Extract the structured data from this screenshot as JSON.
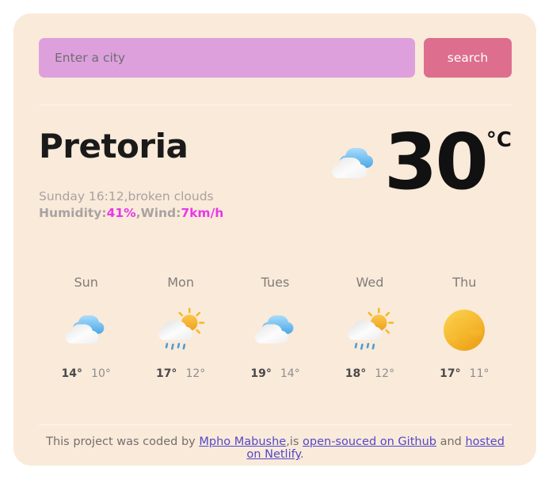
{
  "theme": {
    "page_background": "#ffffff",
    "card_background": "#faeada",
    "input_background": "#dda0dd",
    "button_background": "#dd6e8e",
    "accent_magenta": "#e838e8",
    "link_color": "#5348c8",
    "muted_text": "#a9a2a2",
    "divider_color": "#fdf6ee"
  },
  "search": {
    "placeholder": "Enter a city",
    "value": "",
    "button_label": "search"
  },
  "current": {
    "city": "Pretoria",
    "conditions_line": "Sunday 16:12,broken clouds",
    "humidity_label": "Humidity:",
    "humidity_value": "41%",
    "separator": ",",
    "wind_label": "Wind:",
    "wind_value": "7km/h",
    "temperature": "30",
    "unit": "°C",
    "icon": "broken-clouds-icon"
  },
  "forecast": [
    {
      "day": "Sun",
      "icon": "broken-clouds-icon",
      "temp_max": "14°",
      "temp_min": "10°"
    },
    {
      "day": "Mon",
      "icon": "sun-rain-cloud-icon",
      "temp_max": "17°",
      "temp_min": "12°"
    },
    {
      "day": "Tues",
      "icon": "broken-clouds-icon",
      "temp_max": "19°",
      "temp_min": "14°"
    },
    {
      "day": "Wed",
      "icon": "sun-rain-cloud-icon",
      "temp_max": "18°",
      "temp_min": "12°"
    },
    {
      "day": "Thu",
      "icon": "clear-sun-icon",
      "temp_max": "17°",
      "temp_min": "11°"
    }
  ],
  "footer": {
    "intro": "This project was coded by ",
    "author": "Mpho Mabushe",
    "mid": ",is ",
    "source_link": "open-souced on Github",
    "and": " and ",
    "host_link": "hosted on Netlify",
    "end": "."
  }
}
